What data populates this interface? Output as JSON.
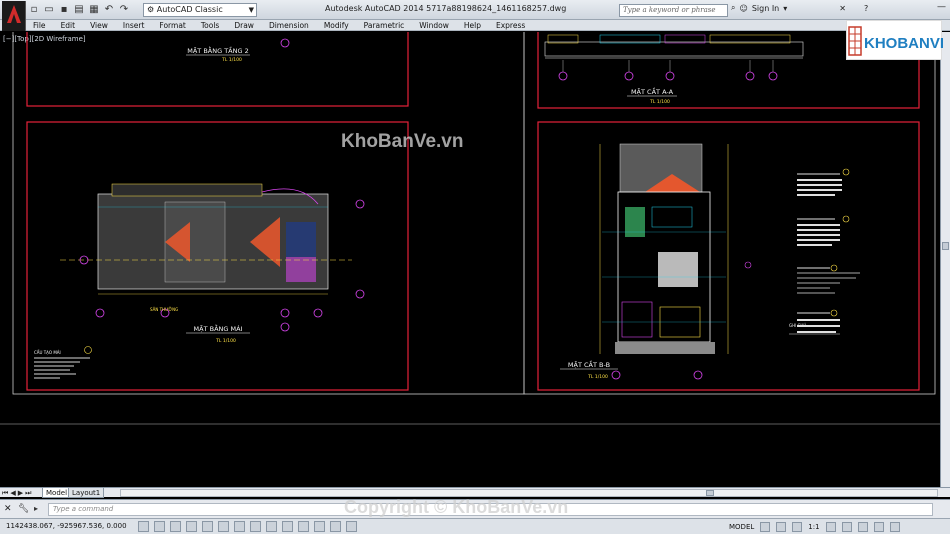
{
  "titlebar": {
    "workspace": "AutoCAD Classic",
    "title": "Autodesk AutoCAD 2014    5717a88198624_1461168257.dwg",
    "search_placeholder": "Type a keyword or phrase",
    "sign_in": "Sign In"
  },
  "menu": [
    "File",
    "Edit",
    "View",
    "Insert",
    "Format",
    "Tools",
    "Draw",
    "Dimension",
    "Modify",
    "Parametric",
    "Window",
    "Help",
    "Express"
  ],
  "viewport": {
    "label": "[−][Top][2D Wireframe]"
  },
  "drawing": {
    "sheet_tl_title": "MẶT BẰNG TẦNG 2",
    "sheet_tl_scale": "TL 1/100",
    "sheet_tr_title": "MẶT CẮT A-A",
    "sheet_tr_scale": "TL 1/100",
    "sheet_bl_title": "MẶT BẰNG MÁI",
    "sheet_bl_scale": "TL 1/100",
    "sheet_br_title": "MẶT CẮT B-B",
    "sheet_br_scale": "TL 1/100",
    "bl_note_title": "CẤU TẠO MÁI",
    "bl_mini_label": "SÂN THƯỠNG",
    "br_notes_title": "GHI CHÚ"
  },
  "watermark": "KhoBanVe.vn",
  "copyright": "Copyright © KhoBanVe.vn",
  "logo": {
    "text": "KHOBANVE"
  },
  "tabs": {
    "model": "Model",
    "layout1": "Layout1"
  },
  "command": {
    "placeholder": "Type a command"
  },
  "status": {
    "coords": "1142438.067, -925967.536, 0.000",
    "model": "MODEL",
    "scale": "1:1"
  },
  "colors": {
    "frame": "#e6213a",
    "background": "#000000",
    "line": "#ffffff",
    "accent_cyan": "#22d3ee",
    "accent_magenta": "#d946ef",
    "accent_yellow": "#fde047"
  }
}
